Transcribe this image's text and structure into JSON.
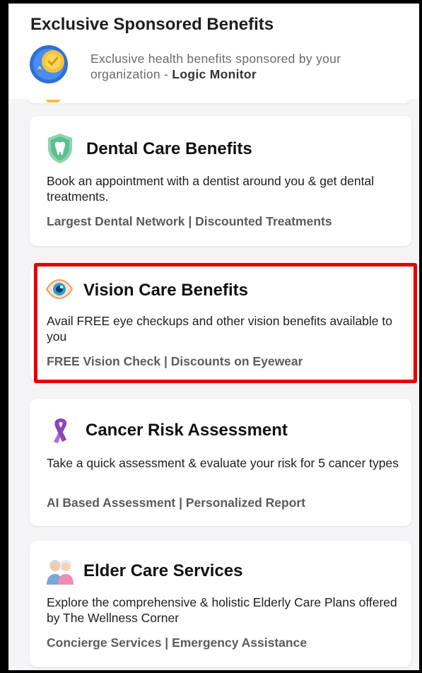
{
  "header": {
    "title": "Exclusive Sponsored Benefits",
    "subtitle_prefix": "Exclusive health benefits sponsored by your organization - ",
    "organization": "Logic Monitor"
  },
  "cards": [
    {
      "icon": "tooth-shield-icon",
      "title": "Dental Care Benefits",
      "description": "Book an appointment with a dentist around you & get dental treatments.",
      "tags": "Largest Dental Network | Discounted Treatments"
    },
    {
      "icon": "eye-icon",
      "title": "Vision Care Benefits",
      "description": "Avail FREE eye checkups and other vision benefits available to you",
      "tags": "FREE Vision Check | Discounts on Eyewear"
    },
    {
      "icon": "awareness-ribbon-icon",
      "title": "Cancer Risk Assessment",
      "description": "Take a quick assessment & evaluate your risk for 5 cancer types",
      "tags": "AI Based Assessment | Personalized Report"
    },
    {
      "icon": "elderly-couple-icon",
      "title": "Elder Care Services",
      "description": "Explore the comprehensive & holistic Elderly Care Plans offered by The Wellness Corner",
      "tags": "Concierge Services | Emergency Assistance"
    }
  ],
  "colors": {
    "highlight": "#e60000",
    "tag_text": "#5c5c5c",
    "background": "#f5f5f7"
  }
}
